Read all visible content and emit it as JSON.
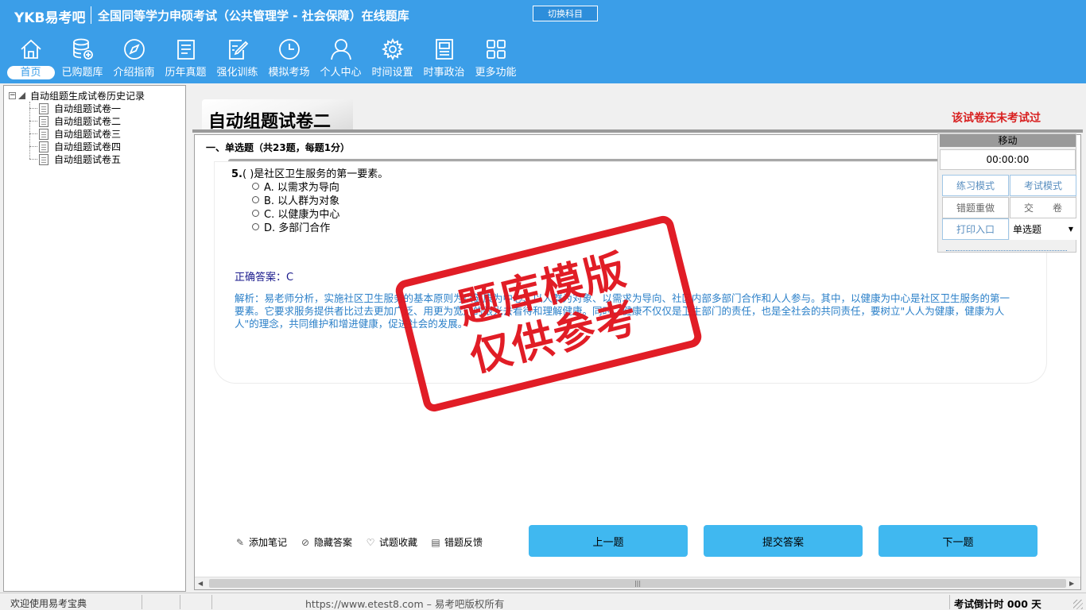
{
  "header": {
    "logo": "YKB易考吧",
    "title": "全国同等学力申硕考试（公共管理学 - 社会保障）在线题库",
    "switch_subject": "切换科目"
  },
  "nav": [
    {
      "label": "首页",
      "icon": "home-icon"
    },
    {
      "label": "已购题库",
      "icon": "database-icon"
    },
    {
      "label": "介绍指南",
      "icon": "compass-icon"
    },
    {
      "label": "历年真题",
      "icon": "document-list-icon"
    },
    {
      "label": "强化训练",
      "icon": "edit-icon"
    },
    {
      "label": "模拟考场",
      "icon": "clock-icon"
    },
    {
      "label": "个人中心",
      "icon": "user-icon"
    },
    {
      "label": "时间设置",
      "icon": "gear-icon"
    },
    {
      "label": "时事政治",
      "icon": "news-icon"
    },
    {
      "label": "更多功能",
      "icon": "grid-icon"
    }
  ],
  "tree": {
    "root": "自动组题生成试卷历史记录",
    "items": [
      "自动组题试卷一",
      "自动组题试卷二",
      "自动组题试卷三",
      "自动组题试卷四",
      "自动组题试卷五"
    ]
  },
  "paper": {
    "title": "自动组题试卷二",
    "status": "该试卷还未考试过",
    "section": "一、单选题（共23题，每题1分）"
  },
  "question": {
    "number": "5.",
    "text": "( )是社区卫生服务的第一要素。",
    "options": [
      "A. 以需求为导向",
      "B. 以人群为对象",
      "C. 以健康为中心",
      "D. 多部门合作"
    ],
    "answer_label": "正确答案：",
    "answer_value": "C",
    "analysis": "解析：易老师分析，实施社区卫生服务的基本原则为以健康为中心、以人群为对象、以需求为导向、社区内部多部门合作和人人参与。其中，以健康为中心是社区卫生服务的第一要素。它要求服务提供者比过去更加广泛、用更为宽广的眼光去看待和理解健康。同时，健康不仅仅是卫生部门的责任，也是全社会的共同责任，要树立\"人人为健康，健康为人人\"的理念，共同维护和增进健康，促进社会的发展。"
  },
  "tools": [
    {
      "label": "添加笔记",
      "icon": "pencil-icon"
    },
    {
      "label": "隐藏答案",
      "icon": "eye-off-icon"
    },
    {
      "label": "试题收藏",
      "icon": "heart-icon"
    },
    {
      "label": "错题反馈",
      "icon": "feedback-icon"
    }
  ],
  "buttons": {
    "prev": "上一题",
    "submit": "提交答案",
    "next": "下一题"
  },
  "exam_box": {
    "move": "移动",
    "timer": "00:00:00",
    "practice_mode": "练习模式",
    "exam_mode": "考试模式",
    "redo_wrong": "错题重做",
    "hand_in": "交　　卷",
    "print": "打印入口",
    "type_select": "单选题"
  },
  "watermark": {
    "line1": "题库模版",
    "line2": "仅供参考"
  },
  "status": {
    "welcome": "欢迎使用易考宝典",
    "copyright": "https://www.etest8.com – 易考吧版权所有",
    "countdown": "考试倒计时 000 天"
  },
  "colors": {
    "header_bg": "#3b9ee8",
    "button_bg": "#40b8f0",
    "accent_red": "#e0141e",
    "analysis_blue": "#2a7fc8"
  }
}
